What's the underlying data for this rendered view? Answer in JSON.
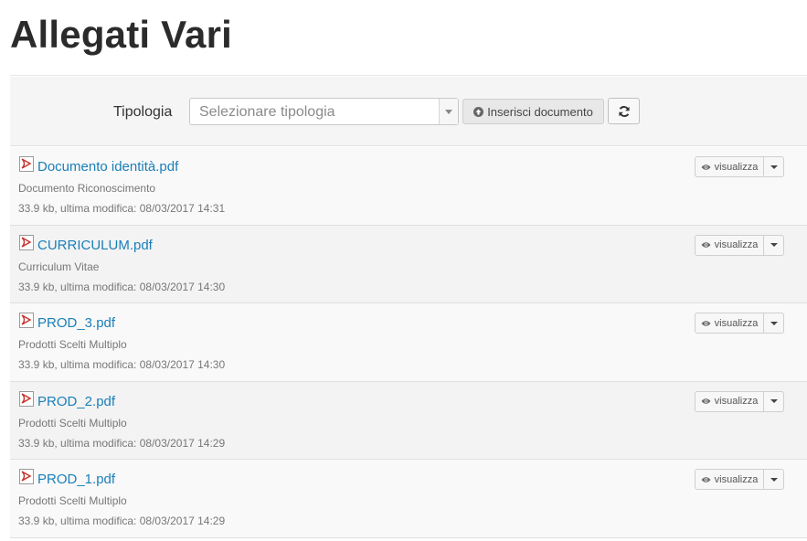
{
  "page": {
    "title": "Allegati Vari"
  },
  "toolbar": {
    "tipologia_label": "Tipologia",
    "select_placeholder": "Selezionare tipologia",
    "insert_button_label": "Inserisci documento",
    "refresh_icon": "refresh-icon"
  },
  "documents": [
    {
      "name": "Documento identità.pdf",
      "type": "Documento Riconoscimento",
      "meta": "33.9 kb, ultima modifica: 08/03/2017 14:31",
      "view_label": "visualizza"
    },
    {
      "name": "CURRICULUM.pdf",
      "type": "Curriculum Vitae",
      "meta": "33.9 kb, ultima modifica: 08/03/2017 14:30",
      "view_label": "visualizza"
    },
    {
      "name": "PROD_3.pdf",
      "type": "Prodotti Scelti Multiplo",
      "meta": "33.9 kb, ultima modifica: 08/03/2017 14:30",
      "view_label": "visualizza"
    },
    {
      "name": "PROD_2.pdf",
      "type": "Prodotti Scelti Multiplo",
      "meta": "33.9 kb, ultima modifica: 08/03/2017 14:29",
      "view_label": "visualizza"
    },
    {
      "name": "PROD_1.pdf",
      "type": "Prodotti Scelti Multiplo",
      "meta": "33.9 kb, ultima modifica: 08/03/2017 14:29",
      "view_label": "visualizza"
    }
  ],
  "colors": {
    "link": "#1a7fb8",
    "pdf_red": "#c4302b"
  }
}
